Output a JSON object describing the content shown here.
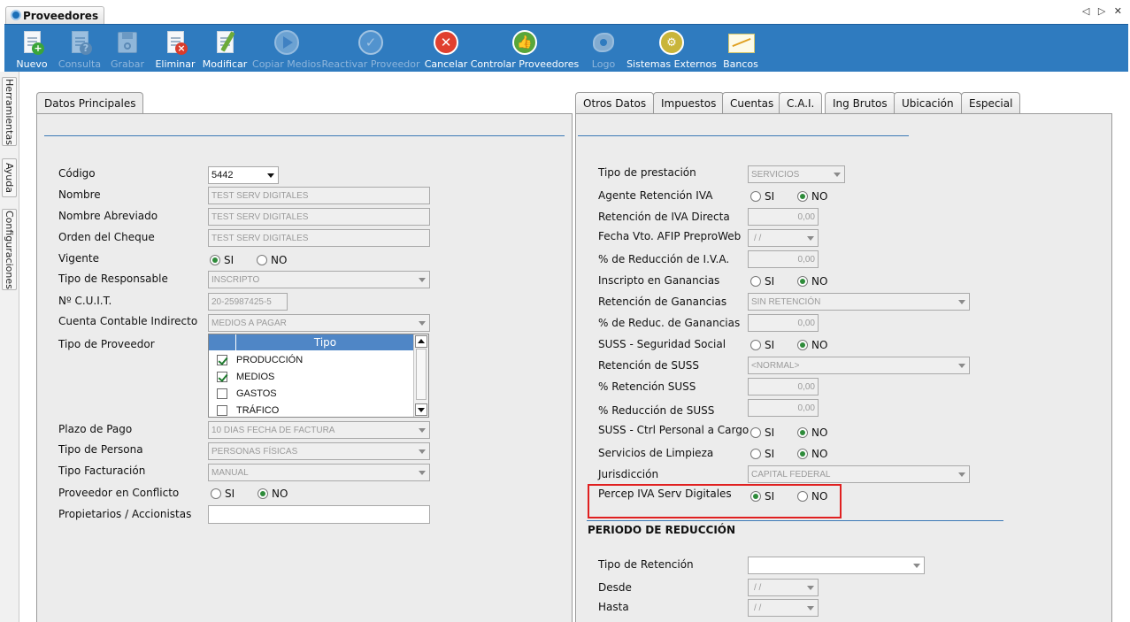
{
  "window": {
    "tab_title": "Proveedores",
    "nav_arrows": "◁ ▷ ✕"
  },
  "toolbar": [
    {
      "label": "Nuevo",
      "icon": "new-document-icon",
      "enabled": true
    },
    {
      "label": "Consulta",
      "icon": "query-document-icon",
      "enabled": false
    },
    {
      "label": "Grabar",
      "icon": "save-disk-icon",
      "enabled": false
    },
    {
      "label": "Eliminar",
      "icon": "delete-document-icon",
      "enabled": true
    },
    {
      "label": "Modificar",
      "icon": "edit-document-icon",
      "enabled": true
    },
    {
      "label": "Copiar Medios",
      "icon": "play-circle-icon",
      "enabled": false
    },
    {
      "label": "Reactivar Proveedor",
      "icon": "check-circle-icon",
      "enabled": false
    },
    {
      "label": "Cancelar",
      "icon": "cancel-circle-icon",
      "enabled": true
    },
    {
      "label": "Controlar Proveedores",
      "icon": "thumbs-up-icon",
      "enabled": true
    },
    {
      "label": "Logo",
      "icon": "logo-shape-icon",
      "enabled": false
    },
    {
      "label": "Sistemas Externos",
      "icon": "external-systems-icon",
      "enabled": true
    },
    {
      "label": "Bancos",
      "icon": "chart-bank-icon",
      "enabled": true
    }
  ],
  "side_tabs": [
    "Herramientas",
    "Ayuda",
    "Configuraciones"
  ],
  "left_panel": {
    "tab": "Datos Principales",
    "codigo": {
      "label": "Código",
      "value": "5442"
    },
    "nombre": {
      "label": "Nombre",
      "value": "TEST SERV DIGITALES"
    },
    "nombre_abreviado": {
      "label": "Nombre Abreviado",
      "value": "TEST SERV DIGITALES"
    },
    "orden_cheque": {
      "label": "Orden del Cheque",
      "value": "TEST SERV DIGITALES"
    },
    "vigente": {
      "label": "Vigente",
      "si": "SI",
      "no": "NO",
      "selected": "SI"
    },
    "tipo_responsable": {
      "label": "Tipo de Responsable",
      "value": "INSCRIPTO"
    },
    "cuit": {
      "label": "Nº C.U.I.T.",
      "value": "20-25987425-5"
    },
    "cuenta_contable": {
      "label": "Cuenta Contable Indirecto",
      "value": "MEDIOS A PAGAR"
    },
    "tipo_proveedor": {
      "label": "Tipo de Proveedor",
      "column": "Tipo",
      "rows": [
        {
          "name": "PRODUCCIÓN",
          "checked": true
        },
        {
          "name": "MEDIOS",
          "checked": true
        },
        {
          "name": "GASTOS",
          "checked": false
        },
        {
          "name": "TRÁFICO",
          "checked": false
        }
      ]
    },
    "plazo_pago": {
      "label": "Plazo de Pago",
      "value": "10 DIAS FECHA DE FACTURA"
    },
    "tipo_persona": {
      "label": "Tipo de Persona",
      "value": "PERSONAS FÍSICAS"
    },
    "tipo_facturacion": {
      "label": "Tipo Facturación",
      "value": "MANUAL"
    },
    "conflicto": {
      "label": "Proveedor en Conflicto",
      "si": "SI",
      "no": "NO",
      "selected": "NO"
    },
    "propietarios": {
      "label": "Propietarios / Accionistas",
      "value": ""
    }
  },
  "right_panel": {
    "tabs": [
      "Otros Datos",
      "Impuestos",
      "Cuentas",
      "C.A.I.",
      "Ing Brutos",
      "Ubicación",
      "Especial"
    ],
    "active_tab": "Impuestos",
    "tipo_prestacion": {
      "label": "Tipo de prestación",
      "value": "SERVICIOS"
    },
    "agente_ret_iva": {
      "label": "Agente Retención IVA",
      "si": "SI",
      "no": "NO",
      "selected": "NO"
    },
    "ret_iva_directa": {
      "label": "Retención de IVA Directa",
      "value": "0,00"
    },
    "fecha_vto_afip": {
      "label": "Fecha Vto. AFIP PreproWeb",
      "value": "/ /"
    },
    "reduccion_iva": {
      "label": "% de Reducción de I.V.A.",
      "value": "0,00"
    },
    "inscripto_ganancias": {
      "label": "Inscripto en Ganancias",
      "si": "SI",
      "no": "NO",
      "selected": "NO"
    },
    "ret_ganancias": {
      "label": "Retención de Ganancias",
      "value": "SIN RETENCIÓN"
    },
    "reduc_ganancias": {
      "label": "% de Reduc. de Ganancias",
      "value": "0,00"
    },
    "suss": {
      "label": "SUSS - Seguridad Social",
      "si": "SI",
      "no": "NO",
      "selected": "NO"
    },
    "ret_suss": {
      "label": "Retención de SUSS",
      "value": "<NORMAL>"
    },
    "pct_ret_suss": {
      "label": "% Retención SUSS",
      "value": "0,00"
    },
    "pct_reduc_suss": {
      "label": "% Reducción de SUSS",
      "value": "0,00"
    },
    "suss_ctrl": {
      "label": "SUSS - Ctrl Personal a Cargo",
      "si": "SI",
      "no": "NO",
      "selected": "NO"
    },
    "limpieza": {
      "label": "Servicios de Limpieza",
      "si": "SI",
      "no": "NO",
      "selected": "NO"
    },
    "jurisdiccion": {
      "label": "Jurisdicción",
      "value": "CAPITAL FEDERAL"
    },
    "percep_iva": {
      "label": "Percep IVA Serv Digitales",
      "si": "SI",
      "no": "NO",
      "selected": "SI"
    },
    "periodo_title": "PERIODO DE REDUCCIÓN",
    "tipo_retencion": {
      "label": "Tipo de Retención",
      "value": ""
    },
    "desde": {
      "label": "Desde",
      "value": "/ /"
    },
    "hasta": {
      "label": "Hasta",
      "value": "/ /"
    }
  },
  "colors": {
    "toolbar": "#2f7bbf",
    "rule": "#3b79b6",
    "highlight": "#e02020",
    "radio_on": "#2e8b3a"
  }
}
